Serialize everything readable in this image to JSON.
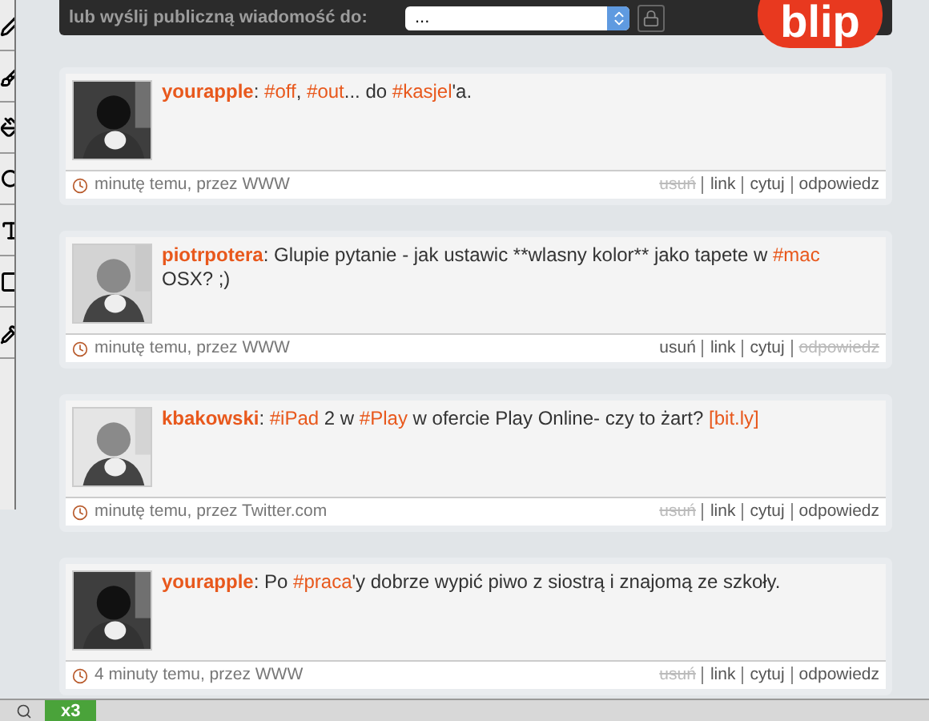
{
  "header": {
    "label": "lub wyślij publiczną wiadomość do:",
    "recipient_select": {
      "value": "..."
    },
    "logo": "blip"
  },
  "posts": [
    {
      "segments": [
        {
          "kind": "user",
          "text": "yourapple"
        },
        {
          "kind": "text",
          "text": ": "
        },
        {
          "kind": "tag",
          "text": "#off"
        },
        {
          "kind": "text",
          "text": ", "
        },
        {
          "kind": "tag",
          "text": "#out"
        },
        {
          "kind": "text",
          "text": "... do "
        },
        {
          "kind": "tag",
          "text": "#kasjel"
        },
        {
          "kind": "text",
          "text": "'a."
        }
      ],
      "meta": "minutę temu, przez WWW",
      "actions": [
        {
          "label": "usuń",
          "disabled": true
        },
        {
          "label": "link",
          "disabled": false
        },
        {
          "label": "cytuj",
          "disabled": false
        },
        {
          "label": "odpowiedz",
          "disabled": false
        }
      ]
    },
    {
      "segments": [
        {
          "kind": "user",
          "text": "piotrpotera"
        },
        {
          "kind": "text",
          "text": ": Glupie pytanie - jak ustawic **wlasny kolor** jako tapete w "
        },
        {
          "kind": "tag",
          "text": "#mac"
        },
        {
          "kind": "text",
          "text": " OSX? ;)"
        }
      ],
      "meta": "minutę temu, przez WWW",
      "actions": [
        {
          "label": "usuń",
          "disabled": false
        },
        {
          "label": "link",
          "disabled": false
        },
        {
          "label": "cytuj",
          "disabled": false
        },
        {
          "label": "odpowiedz",
          "disabled": true
        }
      ]
    },
    {
      "segments": [
        {
          "kind": "user",
          "text": "kbakowski"
        },
        {
          "kind": "text",
          "text": ": "
        },
        {
          "kind": "tag",
          "text": "#iPad"
        },
        {
          "kind": "text",
          "text": " 2 w "
        },
        {
          "kind": "tag",
          "text": "#Play"
        },
        {
          "kind": "text",
          "text": " w ofercie Play Online- czy to żart? "
        },
        {
          "kind": "link",
          "text": "[bit.ly]"
        }
      ],
      "meta": "minutę temu, przez Twitter.com",
      "actions": [
        {
          "label": "usuń",
          "disabled": true
        },
        {
          "label": "link",
          "disabled": false
        },
        {
          "label": "cytuj",
          "disabled": false
        },
        {
          "label": "odpowiedz",
          "disabled": false
        }
      ]
    },
    {
      "segments": [
        {
          "kind": "user",
          "text": "yourapple"
        },
        {
          "kind": "text",
          "text": ": Po "
        },
        {
          "kind": "tag",
          "text": "#praca"
        },
        {
          "kind": "text",
          "text": "'y dobrze wypić piwo z siostrą i znajomą ze szkoły."
        }
      ],
      "meta": "4 minuty temu, przez WWW",
      "actions": [
        {
          "label": "usuń",
          "disabled": true
        },
        {
          "label": "link",
          "disabled": false
        },
        {
          "label": "cytuj",
          "disabled": false
        },
        {
          "label": "odpowiedz",
          "disabled": false
        }
      ]
    }
  ],
  "taskbar": {
    "badge": "x3"
  }
}
